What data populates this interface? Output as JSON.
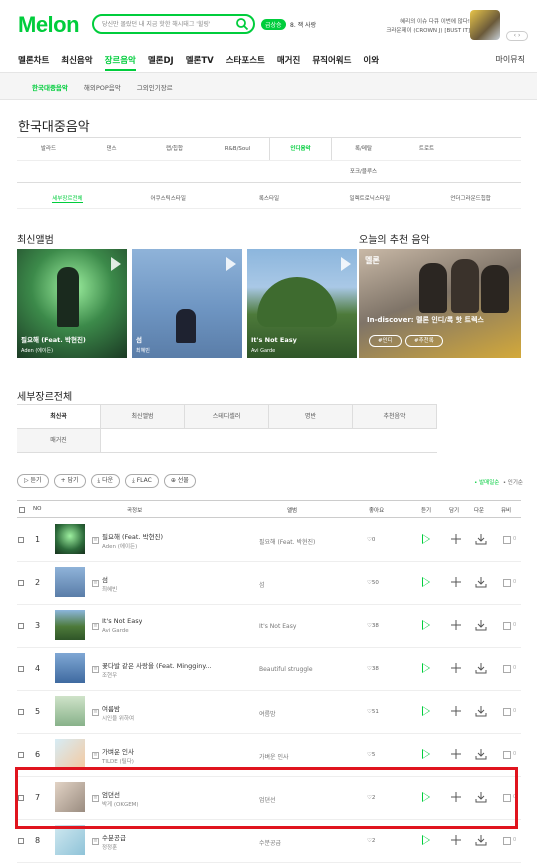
{
  "header": {
    "logo": "Melon",
    "search_placeholder": "당신만 몰랐던 내 지금 핫한 해시태그 '힐링'",
    "new_badge": "급상승",
    "trending": "8. 잭 사랑",
    "promo_line1": "혜리의 이슈 다큐 이번에 않다!",
    "promo_line2": "크라운제이 (CROWN J) [BUST IT]",
    "promo_nav": "‹ ›"
  },
  "gnb": {
    "items": [
      "멜론차트",
      "최신음악",
      "장르음악",
      "멜론DJ",
      "멜론TV",
      "스타포스트",
      "매거진",
      "뮤직어워드",
      "이와"
    ],
    "active_index": 2,
    "mymusic": "마이뮤직"
  },
  "subnav": {
    "items": [
      "한국대중음악",
      "해외POP음악",
      "그외인기장르"
    ],
    "active_index": 0
  },
  "page_title": "한국대중음악",
  "genres": {
    "row1": [
      "발라드",
      "댄스",
      "랩/힙합",
      "R&B/Soul",
      "인디음악",
      "록/메탈",
      "트로트"
    ],
    "row2": [
      "포크/블루스"
    ],
    "active": "인디음악"
  },
  "subgenres": {
    "items": [
      "세부장르전체",
      "어쿠스틱스타일",
      "록스타일",
      "일렉트로닉스타일",
      "언더그라운드힙합"
    ],
    "active_index": 0
  },
  "latest_albums": {
    "title": "최신앨범",
    "items": [
      {
        "title": "필요해 (Feat. 박현진)",
        "artist": "Aden (에이든)"
      },
      {
        "title": "섬",
        "artist": "최혜빈"
      },
      {
        "title": "It's Not Easy",
        "artist": "Avi Garde"
      }
    ]
  },
  "recommend": {
    "title": "오늘의 추천 음악",
    "brand": "멜론",
    "text": "In-discover: 멜론 인디/록 핫 트렉스",
    "btn1": "#인디",
    "btn2": "#추천록"
  },
  "detail": {
    "title": "세부장르전체",
    "tabs_row1": [
      "최신곡",
      "최신앨범",
      "스테디셀러",
      "명반",
      "추천음악"
    ],
    "tabs_row2": [
      "매거진"
    ],
    "active_tab": "최신곡"
  },
  "toolbar": {
    "buttons": [
      "▷ 듣기",
      "+ 담기",
      "⤓ 다운",
      "⤓ FLAC",
      "⊕ 선물"
    ],
    "sort_active": "• 발매일순",
    "sort_other": "• 인기순"
  },
  "table": {
    "headers": {
      "no": "NO",
      "song": "곡정보",
      "album": "앨범",
      "likes": "좋아요",
      "listen": "듣기",
      "add": "담기",
      "download": "다운",
      "mv": "뮤비"
    },
    "rows": [
      {
        "rank": "1",
        "song": "필요해 (Feat. 박현진)",
        "artist": "Aden (에이든)",
        "album": "필요해 (Feat. 박현진)",
        "likes": "0"
      },
      {
        "rank": "2",
        "song": "섬",
        "artist": "최혜빈",
        "album": "섬",
        "likes": "50"
      },
      {
        "rank": "3",
        "song": "It's Not Easy",
        "artist": "Avi Garde",
        "album": "It's Not Easy",
        "likes": "38"
      },
      {
        "rank": "4",
        "song": "꽃다발 같은 사랑을 (Feat. Mingginy...",
        "artist": "조현우",
        "album": "Beautiful struggle",
        "likes": "38"
      },
      {
        "rank": "5",
        "song": "여름밤",
        "artist": "시인을 위하여",
        "album": "여름밤",
        "likes": "51"
      },
      {
        "rank": "6",
        "song": "가벼운 인사",
        "artist": "TILDE (틸다)",
        "album": "가벼운 인사",
        "likes": "5"
      },
      {
        "rank": "7",
        "song": "엄뎐선",
        "artist": "박게 (OKGEM)",
        "album": "엄뎐선",
        "likes": "2"
      },
      {
        "rank": "8",
        "song": "수분공급",
        "artist": "정정훈",
        "album": "수분공급",
        "likes": "2"
      }
    ],
    "mv_count": "0"
  },
  "colors": {
    "accent": "#00cd3c",
    "highlight": "#e0141e"
  }
}
